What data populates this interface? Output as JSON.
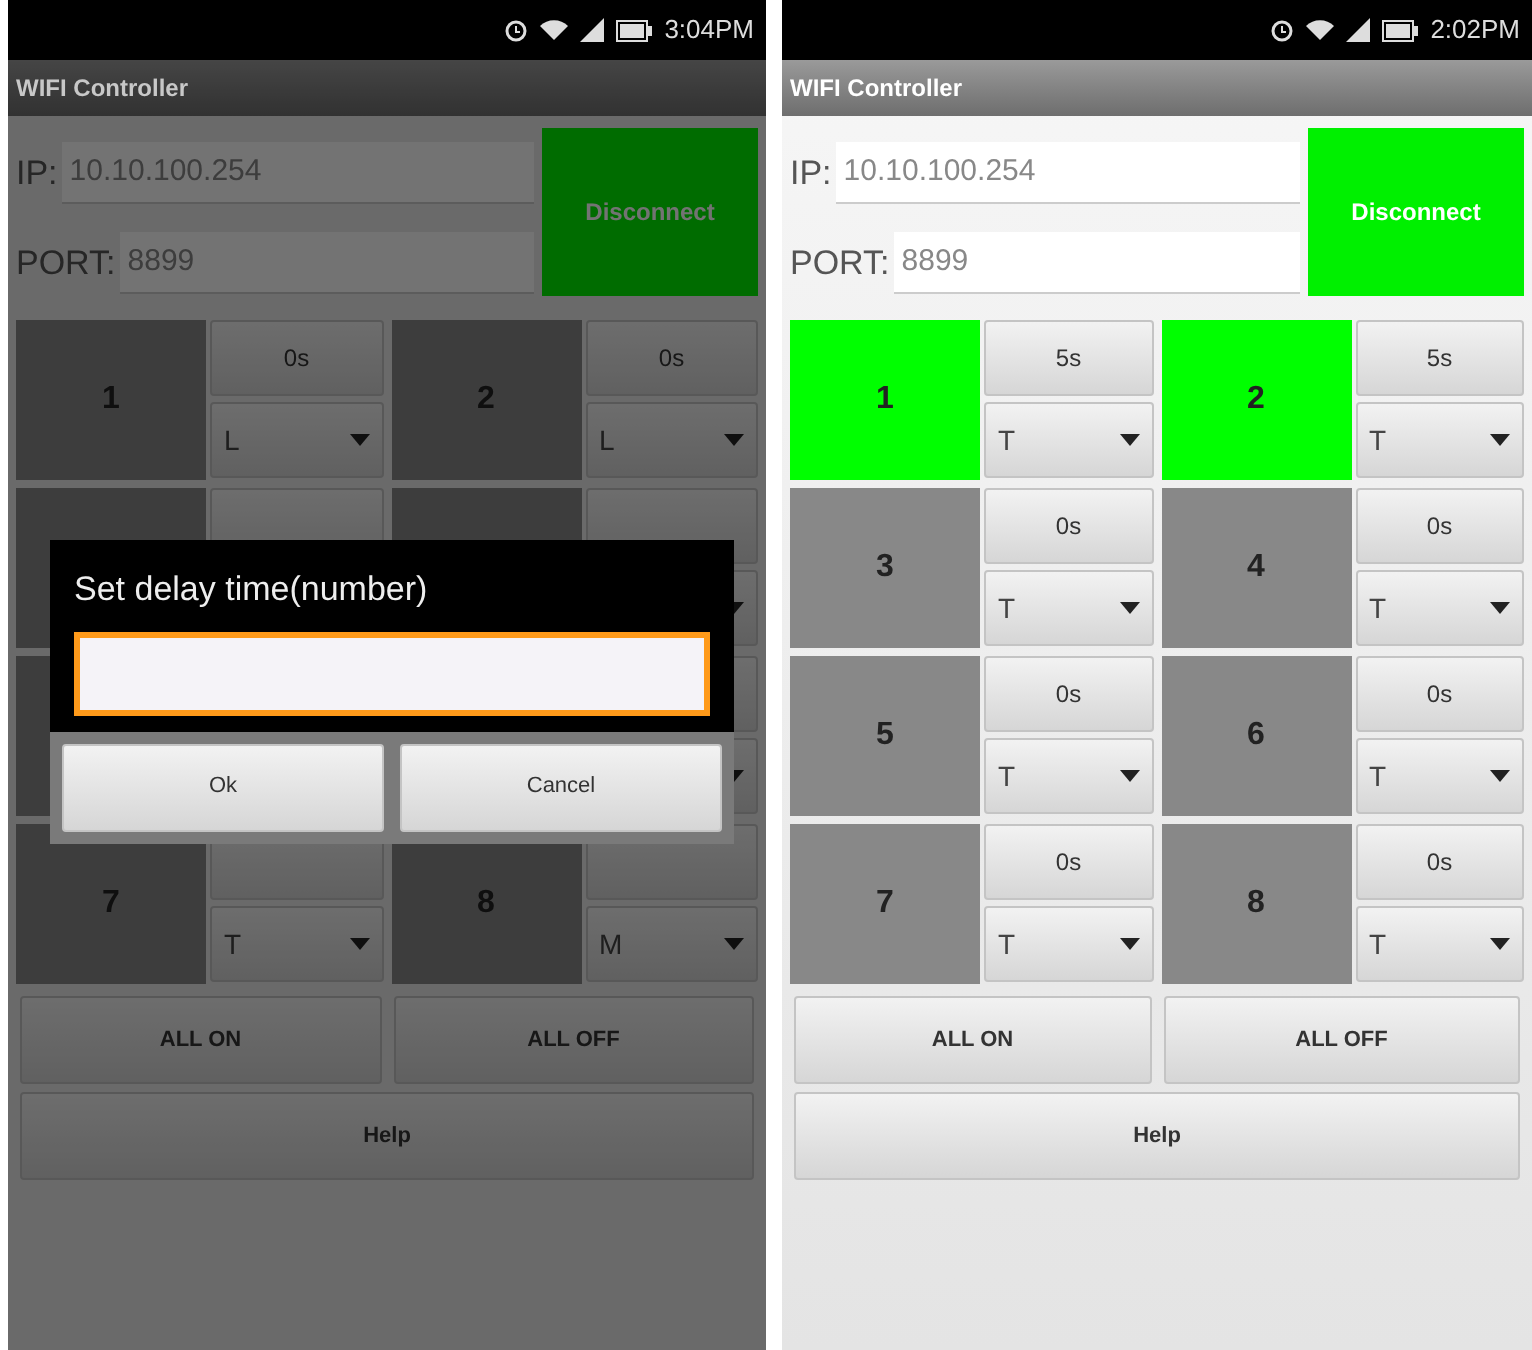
{
  "phones": [
    {
      "status_bar": {
        "time": "3:04PM"
      },
      "title": "WIFI Controller",
      "dimmed": true,
      "ip_label": "IP:",
      "ip_value": "10.10.100.254",
      "port_label": "PORT:",
      "port_value": "8899",
      "connect_button": "Disconnect",
      "relay_rows": [
        [
          {
            "number": "1",
            "on": false,
            "delay": "0s",
            "mode": "L"
          },
          {
            "number": "2",
            "on": false,
            "delay": "0s",
            "mode": "L"
          }
        ],
        [
          {
            "on": false
          },
          {
            "on": false
          }
        ],
        [
          {
            "on": false
          }
        ],
        [
          {
            "number": "7",
            "on": false,
            "mode": "T"
          },
          {
            "number": "8",
            "on": false,
            "mode": "M"
          }
        ]
      ],
      "all_on": "ALL ON",
      "all_off": "ALL OFF",
      "help": "Help",
      "dialog": {
        "title": "Set delay time(number)",
        "buttons": [
          "Ok",
          "Cancel"
        ]
      }
    },
    {
      "status_bar": {
        "time": "2:02PM"
      },
      "title": "WIFI Controller",
      "dimmed": false,
      "ip_label": "IP:",
      "ip_value": "10.10.100.254",
      "port_label": "PORT:",
      "port_value": "8899",
      "connect_button": "Disconnect",
      "relay_rows": [
        [
          {
            "number": "1",
            "on": true,
            "delay": "5s",
            "mode": "T"
          },
          {
            "number": "2",
            "on": true,
            "delay": "5s",
            "mode": "T"
          }
        ],
        [
          {
            "number": "3",
            "on": false,
            "delay": "0s",
            "mode": "T"
          },
          {
            "number": "4",
            "on": false,
            "delay": "0s",
            "mode": "T"
          }
        ],
        [
          {
            "number": "5",
            "on": false,
            "delay": "0s",
            "mode": "T"
          },
          {
            "number": "6",
            "on": false,
            "delay": "0s",
            "mode": "T"
          }
        ],
        [
          {
            "number": "7",
            "on": false,
            "delay": "0s",
            "mode": "T"
          },
          {
            "number": "8",
            "on": false,
            "delay": "0s",
            "mode": "T"
          }
        ]
      ],
      "all_on": "ALL ON",
      "all_off": "ALL OFF",
      "help": "Help"
    }
  ]
}
